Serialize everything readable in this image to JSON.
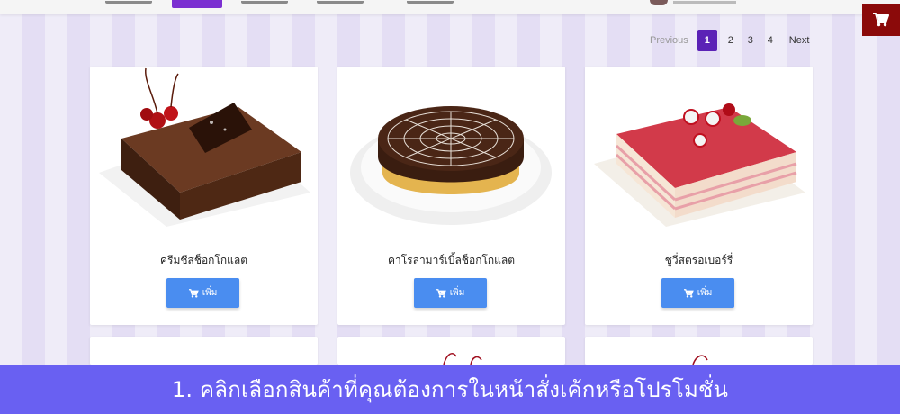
{
  "pagination": {
    "previous": "Previous",
    "pages": [
      "1",
      "2",
      "3",
      "4"
    ],
    "active_page": "1",
    "next": "Next"
  },
  "products": [
    {
      "name": "ครีมชีสช็อกโกแลต",
      "button": "เพิ่ม",
      "image": "square chocolate cake with cherries"
    },
    {
      "name": "คาโรล่ามาร์เบิ้ลช็อกโกแลต",
      "button": "เพิ่ม",
      "image": "round chocolate marble cake on plate"
    },
    {
      "name": "ชูวี่สตรอเบอร์รี่",
      "button": "เพิ่ม",
      "image": "square strawberry layer cake"
    }
  ],
  "icons": {
    "cart": "cart-icon"
  },
  "colors": {
    "accent": "#5b22b6",
    "button": "#4a8df0",
    "banner": "#6960f2",
    "cart_fab": "#8b0a0a"
  },
  "banner": {
    "text": "1. คลิกเลือกสินค้าที่คุณต้องการในหน้าสั่งเค้กหรือโปรโมชั่น"
  }
}
